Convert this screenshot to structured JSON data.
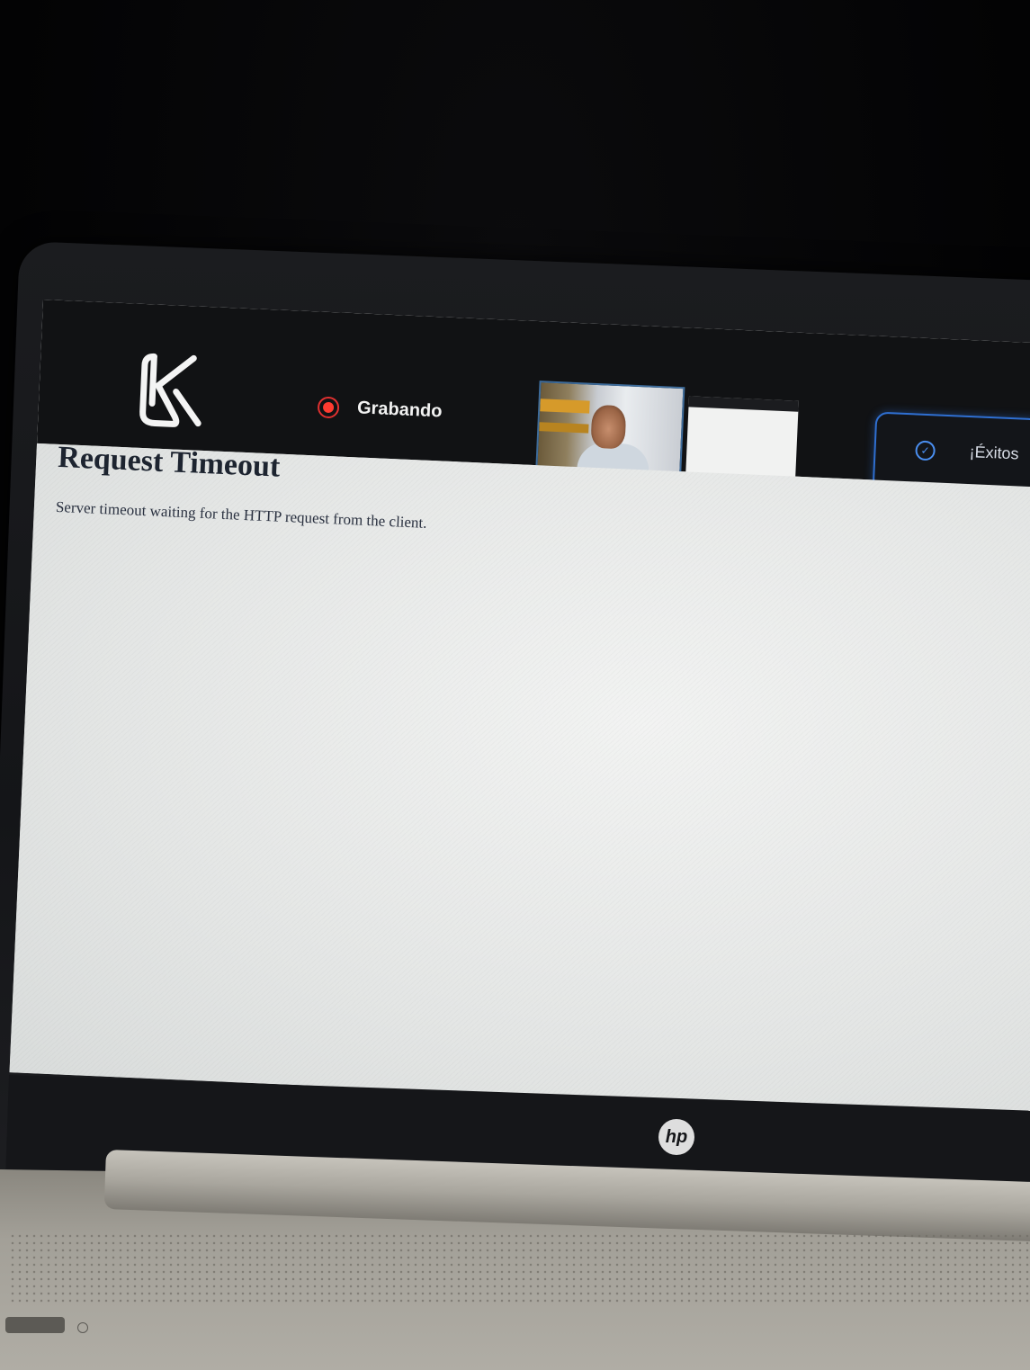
{
  "header": {
    "recording_label": "Grabando",
    "success_text": "¡Éxitos"
  },
  "page": {
    "title": "Request Timeout",
    "message": "Server timeout waiting for the HTTP request from the client."
  },
  "laptop": {
    "brand_logo": "hp"
  },
  "colors": {
    "accent_blue": "#2f6fd1",
    "record_red": "#ff3b30",
    "header_bg": "#111214"
  }
}
